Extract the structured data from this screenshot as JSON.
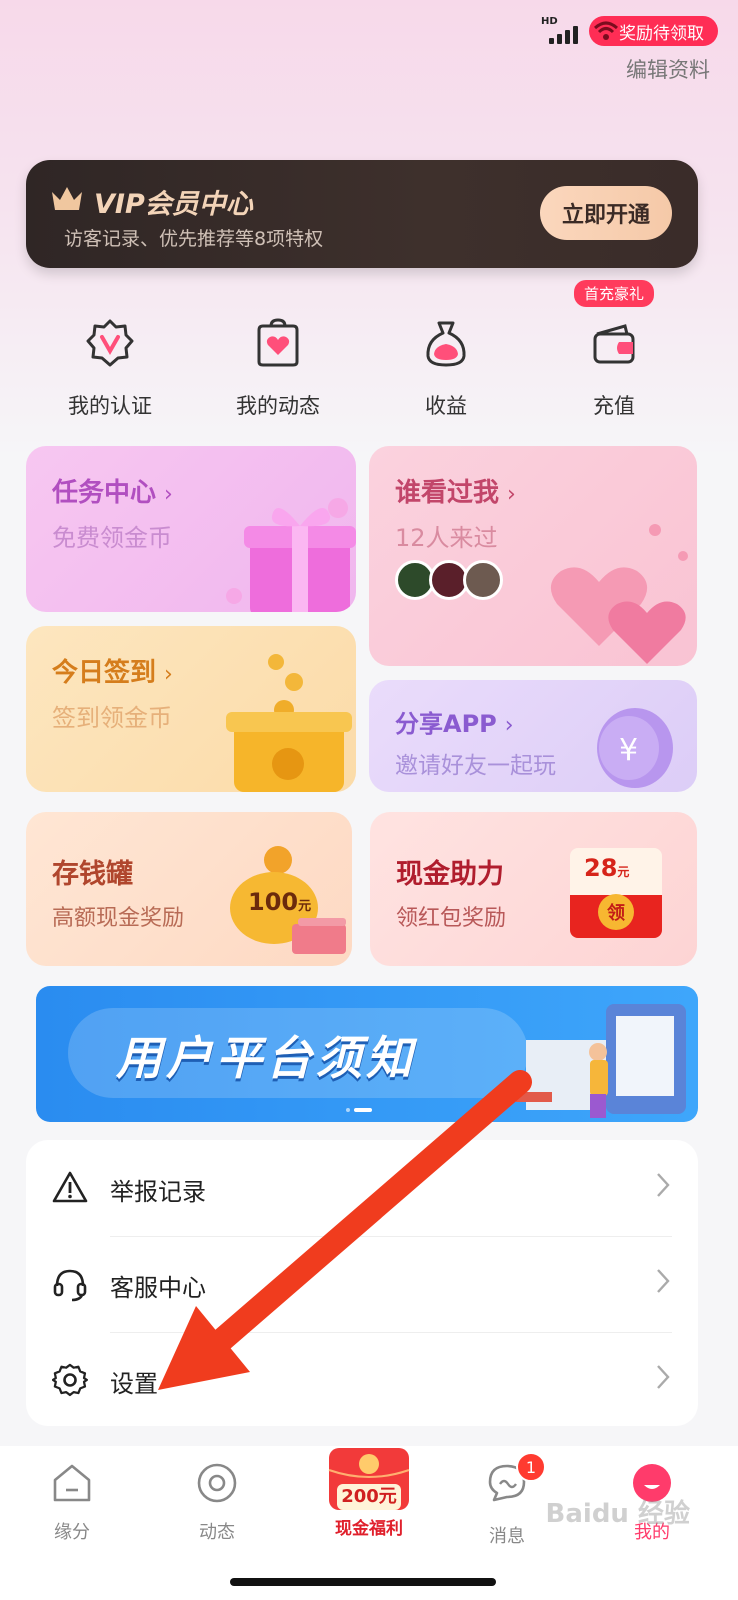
{
  "status": {
    "network": "HD",
    "reward_pill": "奖励待领取"
  },
  "header": {
    "edit_profile": "编辑资料"
  },
  "vip": {
    "title": "VIP会员中心",
    "subtitle": "访客记录、优先推荐等8项特权",
    "button": "立即开通"
  },
  "quick_actions": [
    {
      "label": "我的认证",
      "icon": "verify-badge-icon"
    },
    {
      "label": "我的动态",
      "icon": "moments-heart-icon"
    },
    {
      "label": "收益",
      "icon": "money-bag-icon"
    },
    {
      "label": "充值",
      "icon": "wallet-icon",
      "badge": "首充豪礼"
    }
  ],
  "cards": {
    "task": {
      "title": "任务中心",
      "subtitle": "免费领金币"
    },
    "visitors": {
      "title": "谁看过我",
      "subtitle": "12人来过"
    },
    "signin": {
      "title": "今日签到",
      "subtitle": "签到领金币"
    },
    "share": {
      "title": "分享APP",
      "subtitle": "邀请好友一起玩"
    },
    "piggy": {
      "title": "存钱罐",
      "subtitle": "高额现金奖励",
      "amount": "100",
      "unit": "元"
    },
    "cash_help": {
      "title": "现金助力",
      "subtitle": "领红包奖励",
      "amount": "28",
      "unit": "元",
      "claim": "领"
    }
  },
  "banner": {
    "title": "用户平台须知"
  },
  "menu": [
    {
      "label": "举报记录",
      "icon": "warning-triangle-icon"
    },
    {
      "label": "客服中心",
      "icon": "headset-icon"
    },
    {
      "label": "设置",
      "icon": "gear-icon"
    }
  ],
  "tabbar": {
    "tabs": [
      {
        "label": "缘分",
        "icon": "home-icon"
      },
      {
        "label": "动态",
        "icon": "moments-circle-icon"
      },
      {
        "label": "现金福利",
        "icon": "red-envelope-icon",
        "amount": "200元"
      },
      {
        "label": "消息",
        "icon": "chat-bubble-icon",
        "badge": "1"
      },
      {
        "label": "我的",
        "icon": "profile-face-icon"
      }
    ]
  },
  "watermark": "Baidu 经验",
  "colors": {
    "accent_pink": "#ff3b5c",
    "vip_gold": "#f3d4b8",
    "banner_blue": "#2a8cf0",
    "annotation_red": "#f03c1e"
  }
}
